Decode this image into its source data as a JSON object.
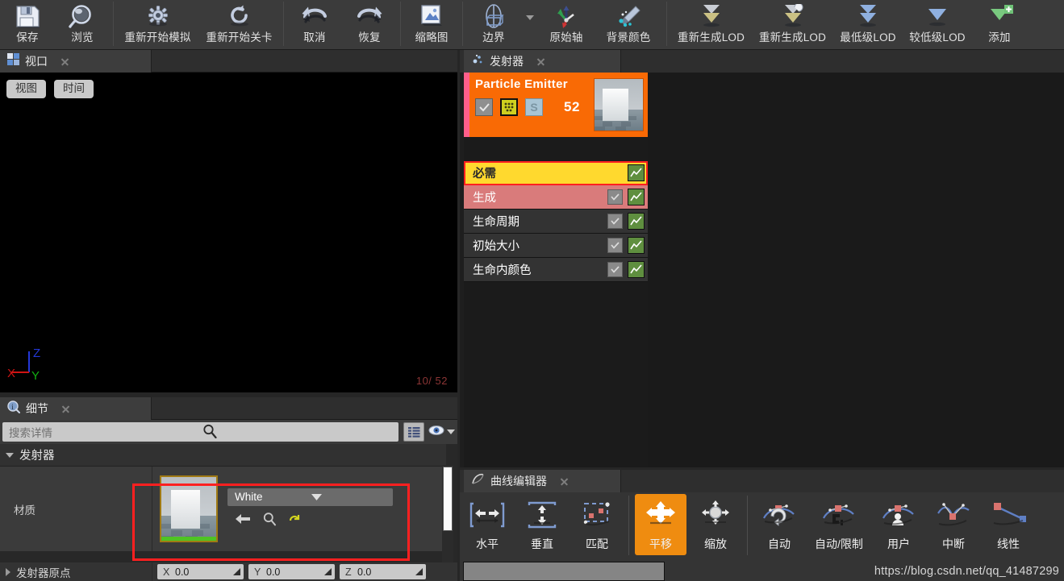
{
  "toolbar": {
    "items": [
      {
        "label": "保存",
        "icon": "save-icon"
      },
      {
        "label": "浏览",
        "icon": "browse-icon"
      },
      {
        "label": "重新开始模拟",
        "icon": "restart-sim-icon"
      },
      {
        "label": "重新开始关卡",
        "icon": "restart-level-icon"
      },
      {
        "label": "取消",
        "icon": "undo-icon"
      },
      {
        "label": "恢复",
        "icon": "redo-icon"
      },
      {
        "label": "缩略图",
        "icon": "thumbnail-icon"
      },
      {
        "label": "边界",
        "icon": "bounds-icon"
      },
      {
        "label": "原始轴",
        "icon": "origin-axis-icon"
      },
      {
        "label": "背景颜色",
        "icon": "background-color-icon"
      },
      {
        "label": "重新生成LOD",
        "icon": "regenerate-lod-icon"
      },
      {
        "label": "重新生成LOD",
        "icon": "regenerate-lod-dup-icon"
      },
      {
        "label": "最低级LOD",
        "icon": "lowest-lod-icon"
      },
      {
        "label": "较低级LOD",
        "icon": "lower-lod-icon"
      },
      {
        "label": "添加",
        "icon": "add-lod-icon"
      }
    ]
  },
  "viewport": {
    "tab_title": "视口",
    "buttons": [
      {
        "label": "视图"
      },
      {
        "label": "时间"
      }
    ],
    "axis": {
      "x": "X",
      "y": "Y",
      "z": "Z"
    },
    "frame_counter": "10/ 52"
  },
  "details": {
    "tab_title": "细节",
    "search_placeholder": "搜索详情",
    "search_value": "",
    "section_label": "发射器",
    "material_row": {
      "label": "材质",
      "value": "White"
    },
    "origin_row": {
      "label": "发射器原点",
      "fields": [
        {
          "axis": "X",
          "value": "0.0"
        },
        {
          "axis": "Y",
          "value": "0.0"
        },
        {
          "axis": "Z",
          "value": "0.0"
        }
      ]
    }
  },
  "emitter": {
    "tab_title": "发射器",
    "header": {
      "title": "Particle Emitter",
      "count": "52",
      "s_label": "S"
    },
    "modules": [
      {
        "label": "必需",
        "state": "selected",
        "has_checkbox": false
      },
      {
        "label": "生成",
        "state": "spawn",
        "has_checkbox": true
      },
      {
        "label": "生命周期",
        "state": "normal",
        "has_checkbox": true
      },
      {
        "label": "初始大小",
        "state": "normal",
        "has_checkbox": true
      },
      {
        "label": "生命内颜色",
        "state": "normal",
        "has_checkbox": true
      }
    ]
  },
  "curve_editor": {
    "tab_title": "曲线编辑器",
    "items": [
      {
        "label": "水平",
        "icon": "fit-horizontal-icon",
        "active": false
      },
      {
        "label": "垂直",
        "icon": "fit-vertical-icon",
        "active": false
      },
      {
        "label": "匹配",
        "icon": "fit-match-icon",
        "active": false
      },
      {
        "label": "平移",
        "icon": "pan-icon",
        "active": true
      },
      {
        "label": "缩放",
        "icon": "zoom-icon",
        "active": false
      },
      {
        "label": "自动",
        "icon": "tangent-auto-icon",
        "active": false
      },
      {
        "label": "自动/限制",
        "icon": "tangent-auto-clamped-icon",
        "active": false
      },
      {
        "label": "用户",
        "icon": "tangent-user-icon",
        "active": false
      },
      {
        "label": "中断",
        "icon": "tangent-break-icon",
        "active": false
      },
      {
        "label": "线性",
        "icon": "tangent-linear-icon",
        "active": false
      }
    ]
  },
  "watermark": {
    "text": "https://blog.csdn.net/qq_41487299"
  },
  "colors": {
    "emitter_header": "#f96a05",
    "module_selected": "#ffd92e",
    "module_spawn": "#d97b7b",
    "selection_outline": "#ff2020",
    "curve_active": "#ef8c10"
  }
}
